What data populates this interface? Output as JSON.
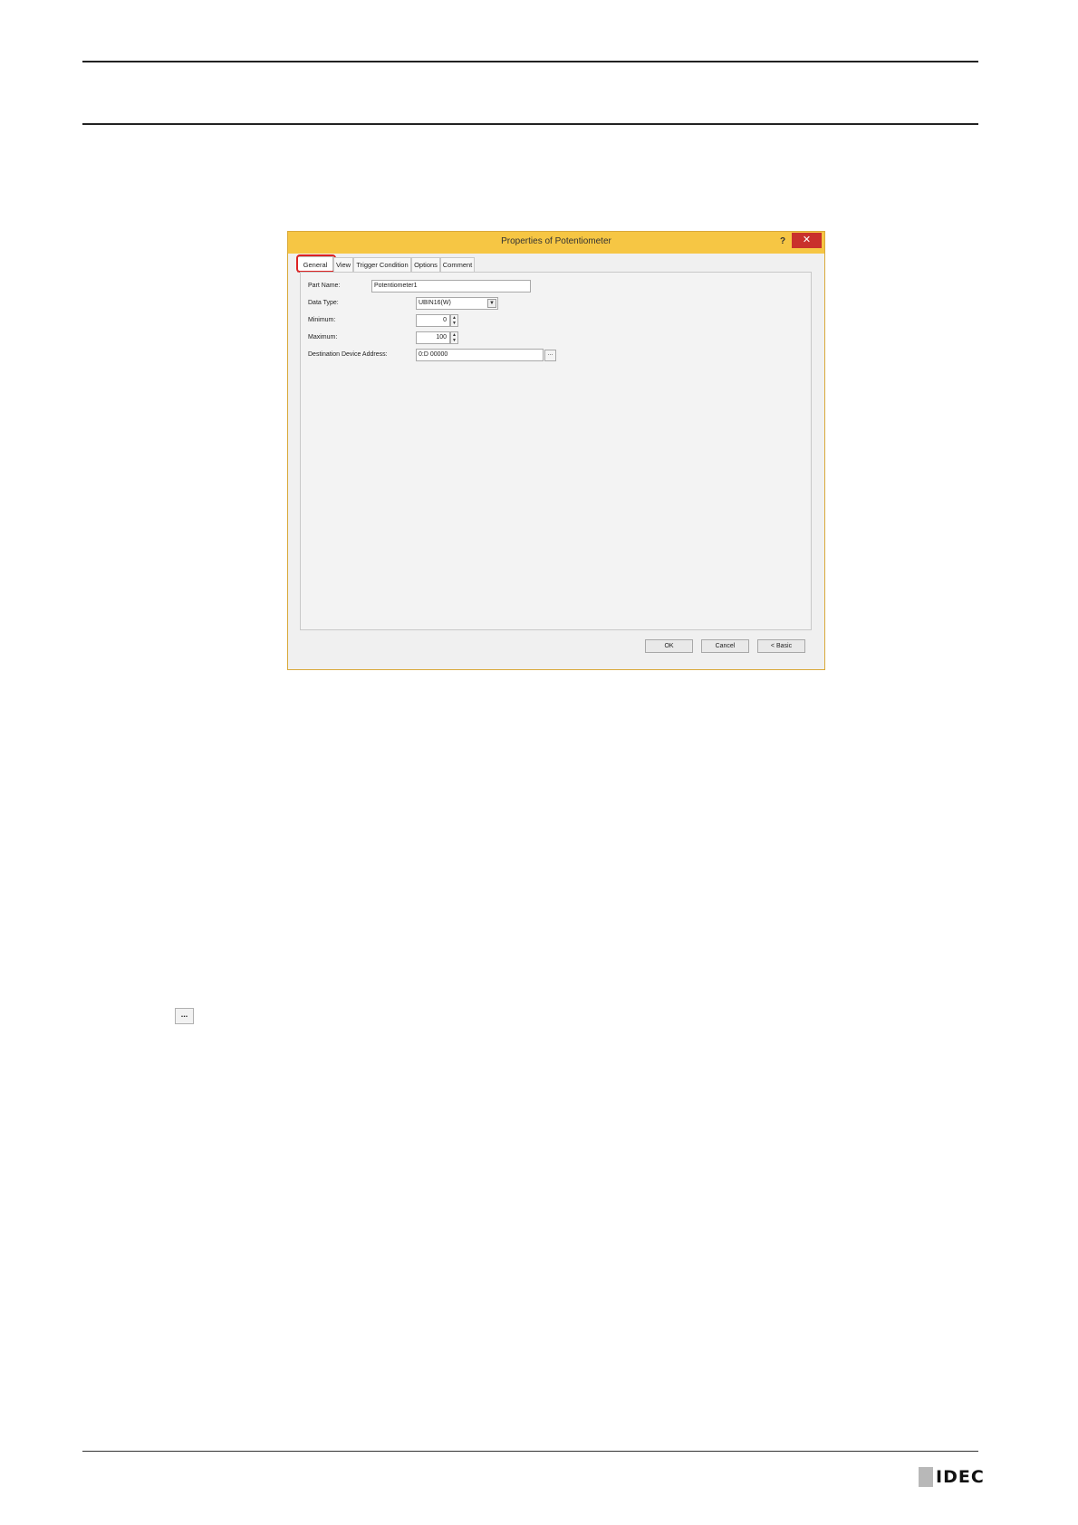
{
  "dialog": {
    "title": "Properties of Potentiometer",
    "help_label": "?",
    "close_label": "✕",
    "tabs": [
      {
        "label": "General"
      },
      {
        "label": "View"
      },
      {
        "label": "Trigger Condition"
      },
      {
        "label": "Options"
      },
      {
        "label": "Comment"
      }
    ],
    "fields": {
      "part_name": {
        "label": "Part Name:",
        "value": "Potentiometer1"
      },
      "data_type": {
        "label": "Data Type:",
        "value": "UBIN16(W)"
      },
      "minimum": {
        "label": "Minimum:",
        "value": "0"
      },
      "maximum": {
        "label": "Maximum:",
        "value": "100"
      },
      "destination": {
        "label": "Destination Device Address:",
        "value": "0:D 00000",
        "browse": "..."
      }
    },
    "buttons": {
      "ok": "OK",
      "cancel": "Cancel",
      "basic": "< Basic"
    }
  },
  "standalone_browse": "...",
  "logo": {
    "text": "IDEC"
  },
  "colors": {
    "title_bar": "#f6c644",
    "close_button": "#c9302c",
    "tab_highlight": "#dd2222"
  }
}
